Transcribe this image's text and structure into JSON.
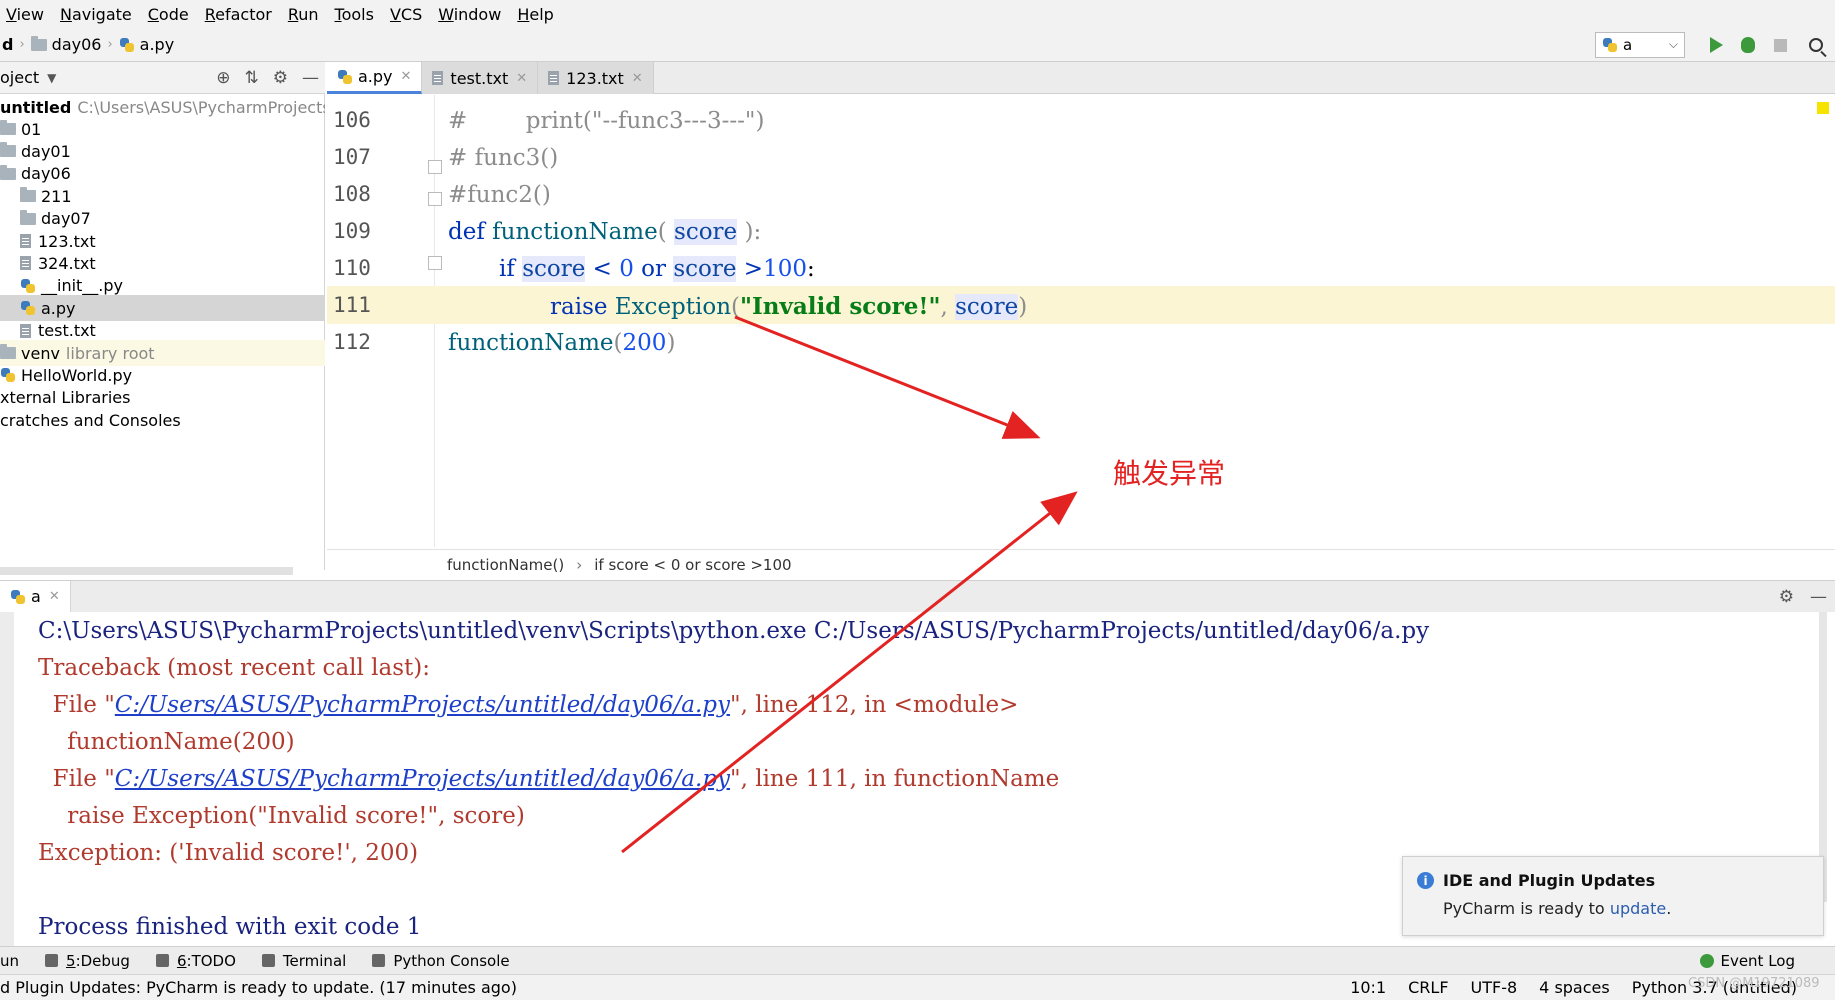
{
  "menu": [
    {
      "label": "View",
      "u": "V",
      "rest": "iew"
    },
    {
      "label": "Navigate",
      "u": "N",
      "rest": "avigate"
    },
    {
      "label": "Code",
      "u": "C",
      "rest": "ode"
    },
    {
      "label": "Refactor",
      "u": "R",
      "rest": "efactor"
    },
    {
      "label": "Run",
      "u": "R",
      "rest": "un"
    },
    {
      "label": "Tools",
      "u": "T",
      "rest": "ools"
    },
    {
      "label": "VCS",
      "u": "V",
      "rest": "CS"
    },
    {
      "label": "Window",
      "u": "W",
      "rest": "indow"
    },
    {
      "label": "Help",
      "u": "H",
      "rest": "elp"
    }
  ],
  "nav": {
    "root": "d",
    "folder": "day06",
    "file": "a.py"
  },
  "run_config": {
    "name": "a"
  },
  "project": {
    "header": "oject",
    "root_label": "untitled",
    "root_path": "C:\\Users\\ASUS\\PycharmProjects\\unti",
    "items": [
      {
        "label": "01",
        "kind": "folder"
      },
      {
        "label": "day01",
        "kind": "folder"
      },
      {
        "label": "day06",
        "kind": "folder"
      },
      {
        "label": "211",
        "kind": "folder"
      },
      {
        "label": "day07",
        "kind": "folder"
      },
      {
        "label": "123.txt",
        "kind": "txt"
      },
      {
        "label": "324.txt",
        "kind": "txt"
      },
      {
        "label": "__init__.py",
        "kind": "py"
      },
      {
        "label": "a.py",
        "kind": "py"
      },
      {
        "label": "test.txt",
        "kind": "txt"
      },
      {
        "label": "venv",
        "kind": "folder",
        "note": "library root"
      },
      {
        "label": "HelloWorld.py",
        "kind": "py"
      },
      {
        "label": "xternal Libraries",
        "kind": "plain"
      },
      {
        "label": "cratches and Consoles",
        "kind": "plain"
      }
    ]
  },
  "tabs": [
    {
      "label": "a.py",
      "kind": "py"
    },
    {
      "label": "test.txt",
      "kind": "txt"
    },
    {
      "label": "123.txt",
      "kind": "txt"
    }
  ],
  "editor": {
    "line_numbers": [
      "106",
      "107",
      "108",
      "109",
      "110",
      "111",
      "112"
    ],
    "lines": {
      "l106": "#        print(\"--func3---3---\")",
      "l107": "# func3()",
      "l108": "#func2()",
      "l109_kw": "def ",
      "l109_fn": "functionName",
      "l109_a": "( ",
      "l109_var": "score",
      "l109_b": " ):",
      "l110_kw": "if ",
      "l110_v1": "score",
      "l110_a": " < ",
      "l110_n1": "0",
      "l110_or": " or ",
      "l110_v2": "score",
      "l110_b": " >",
      "l110_n2": "100",
      "l110_c": ":",
      "l111_kw": "raise ",
      "l111_fn": "Exception",
      "l111_a": "(",
      "l111_str": "\"Invalid score!\"",
      "l111_b": ", ",
      "l111_var": "score",
      "l111_c": ")",
      "l112_fn": "functionName",
      "l112_a": "(",
      "l112_n": "200",
      "l112_b": ")"
    },
    "breadcrumb": [
      "functionName()",
      "if score < 0 or score >100"
    ]
  },
  "run_panel": {
    "tab": "a",
    "lines": {
      "cmd": "C:\\Users\\ASUS\\PycharmProjects\\untitled\\venv\\Scripts\\python.exe C:/Users/ASUS/PycharmProjects/untitled/day06/a.py",
      "tb": "Traceback (most recent call last):",
      "f1_pre": "  File \"",
      "f1_link": "C:/Users/ASUS/PycharmProjects/untitled/day06/a.py",
      "f1_post": "\", line 112, in <module>",
      "c1": "    functionName(200)",
      "f2_pre": "  File \"",
      "f2_link": "C:/Users/ASUS/PycharmProjects/untitled/day06/a.py",
      "f2_post": "\", line 111, in functionName",
      "c2": "    raise Exception(\"Invalid score!\", score)",
      "exc": "Exception: ('Invalid score!', 200)",
      "done": "Process finished with exit code 1"
    }
  },
  "notification": {
    "title": "IDE and Plugin Updates",
    "body": "PyCharm is ready to ",
    "link": "update",
    "tail": "."
  },
  "tool_windows": [
    {
      "label": "un",
      "num": ""
    },
    {
      "label": "Debug",
      "num": "5"
    },
    {
      "label": "TODO",
      "num": "6"
    },
    {
      "label": "Terminal",
      "num": ""
    },
    {
      "label": "Python Console",
      "num": ""
    }
  ],
  "event_log": "Event Log",
  "status": {
    "message": "d Plugin Updates: PyCharm is ready to update. (17 minutes ago)",
    "position": "10:1",
    "line_sep": "CRLF",
    "encoding": "UTF-8",
    "indent": "4 spaces",
    "interpreter": "Python 3.7 (untitled)"
  },
  "annotation": {
    "text": "触发异常",
    "color": "#e32222"
  },
  "watermark": "CSDN @M19721089"
}
